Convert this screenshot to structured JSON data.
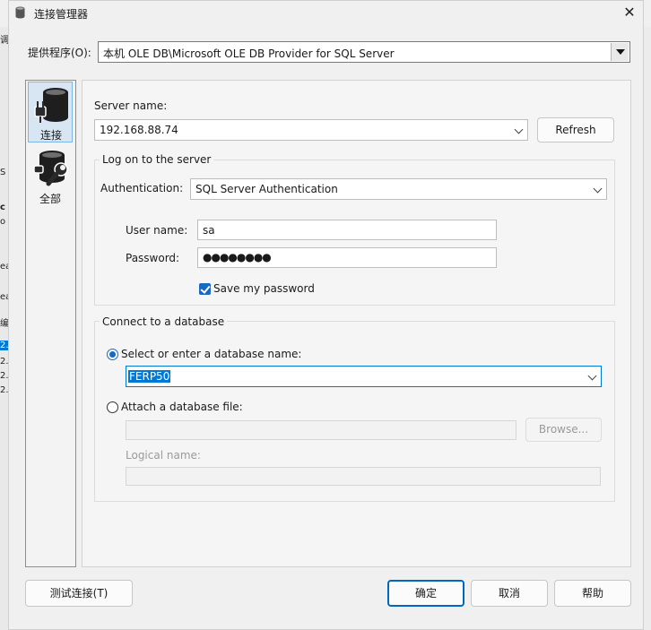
{
  "window": {
    "title": "连接管理器",
    "close_glyph": "✕"
  },
  "background": {
    "edge_text": [
      "调",
      "S",
      "c",
      "o",
      "ea",
      "ea",
      "编",
      "2.",
      "2.",
      "2.",
      "2."
    ]
  },
  "provider": {
    "label": "提供程序(O):",
    "value": "本机 OLE DB\\Microsoft OLE DB Provider for SQL Server"
  },
  "sidebar": {
    "items": [
      {
        "label": "连接",
        "icon": "database-plug-icon"
      },
      {
        "label": "全部",
        "icon": "database-wrench-icon"
      }
    ]
  },
  "server": {
    "label": "Server name:",
    "value": "192.168.88.74",
    "refresh_label": "Refresh"
  },
  "logon": {
    "group_title": "Log on to the server",
    "auth_label": "Authentication:",
    "auth_value": "SQL Server Authentication",
    "user_label": "User name:",
    "user_value": "sa",
    "password_label": "Password:",
    "password_value": "●●●●●●●●",
    "save_password_label": "Save my password",
    "save_password_checked": true
  },
  "database": {
    "group_title": "Connect to a database",
    "select_label": "Select or enter a database name:",
    "select_value": "FERP50",
    "attach_label": "Attach a database file:",
    "attach_value": "",
    "browse_label": "Browse...",
    "logical_label": "Logical name:",
    "logical_value": ""
  },
  "footer": {
    "test_label": "测试连接(T)",
    "ok_label": "确定",
    "cancel_label": "取消",
    "help_label": "帮助"
  },
  "colors": {
    "accent": "#0078d7",
    "check": "#1769c2"
  }
}
